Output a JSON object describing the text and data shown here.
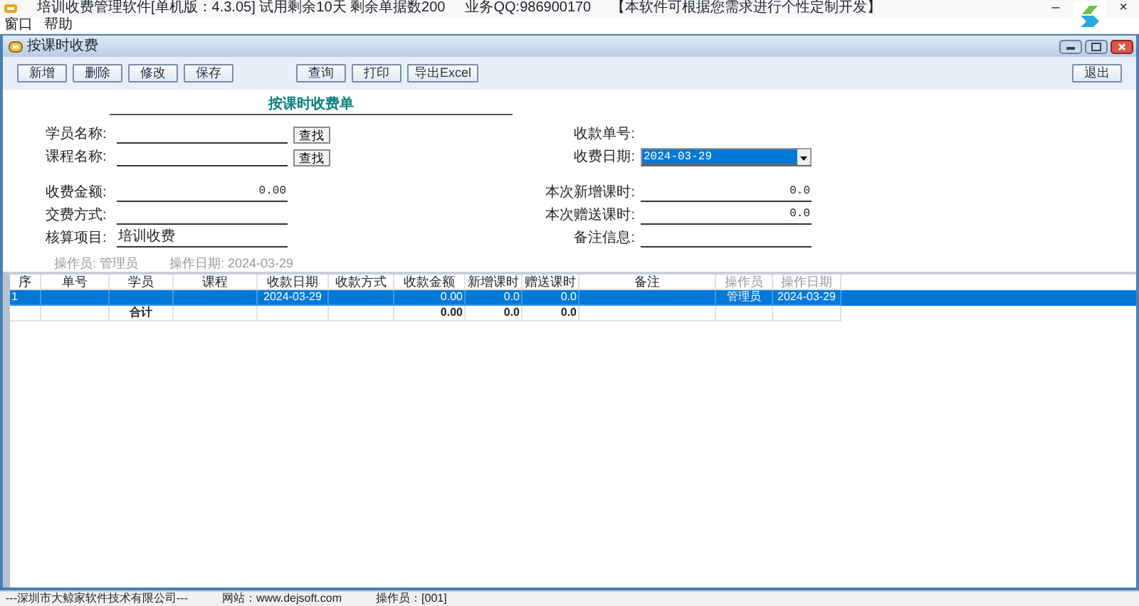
{
  "app": {
    "title": "培训收费管理软件[单机版：4.3.05] 试用剩余10天  剩余单据数200",
    "contact": "业务QQ:986900170",
    "slogan": "【本软件可根据您需求进行个性定制开发】",
    "minimize": "–",
    "close": "×"
  },
  "menu": [
    "窗口",
    "帮助"
  ],
  "child_window": {
    "title": "按课时收费"
  },
  "toolbar": {
    "left": [
      "新增",
      "删除",
      "修改",
      "保存"
    ],
    "middle": [
      "查询",
      "打印",
      "导出Excel"
    ],
    "right": [
      "退出"
    ]
  },
  "form": {
    "title": "按课时收费单",
    "blocks": [
      [
        {
          "left": {
            "kind": "lookup",
            "label": "学员名称:",
            "button": "查找"
          },
          "right": {
            "kind": "text",
            "label": "收款单号:"
          }
        },
        {
          "left": {
            "kind": "lookup",
            "label": "课程名称:",
            "button": "查找"
          },
          "right": {
            "kind": "date",
            "label": "收费日期:",
            "value": "2024-03-29",
            "selected": true
          }
        }
      ],
      [
        {
          "left": {
            "kind": "number",
            "label": "收费金额:",
            "value": "0.00"
          },
          "right": {
            "kind": "number",
            "label": "本次新增课时:",
            "value": "0.0"
          }
        },
        {
          "left": {
            "kind": "input",
            "label": "交费方式:"
          },
          "right": {
            "kind": "number",
            "label": "本次赠送课时:",
            "value": "0.0"
          }
        },
        {
          "left": {
            "kind": "input",
            "label": "核算项目:",
            "value": "培训收费"
          },
          "right": {
            "kind": "input",
            "label": "备注信息:"
          }
        }
      ]
    ],
    "operator": "操作员: 管理员",
    "date": "操作日期: 2024-03-29"
  },
  "table": {
    "columns": [
      {
        "label": "序",
        "muted": false
      },
      {
        "label": "单号",
        "muted": false
      },
      {
        "label": "学员",
        "muted": false
      },
      {
        "label": "课程",
        "muted": false
      },
      {
        "label": "收款日期",
        "muted": false
      },
      {
        "label": "收款方式",
        "muted": false
      },
      {
        "label": "收款金额",
        "muted": false
      },
      {
        "label": "新增课时",
        "muted": false
      },
      {
        "label": "赠送课时",
        "muted": false
      },
      {
        "label": "备注",
        "muted": false
      },
      {
        "label": "操作员",
        "muted": true
      },
      {
        "label": "操作日期",
        "muted": true
      }
    ],
    "rows": [
      {
        "selected": true,
        "cells": [
          "1",
          "",
          "",
          "",
          "2024-03-29",
          "",
          "0.00",
          "0.0",
          "0.0",
          "",
          "管理员",
          "2024-03-29"
        ]
      }
    ],
    "total": {
      "label": "合计",
      "amount": "0.00",
      "added_hours": "0.0",
      "gift_hours": "0.0"
    }
  },
  "status_bar": [
    "---深圳市大鲸家软件技术有限公司---",
    "网站：www.dejsoft.com",
    "操作员：[001]"
  ]
}
